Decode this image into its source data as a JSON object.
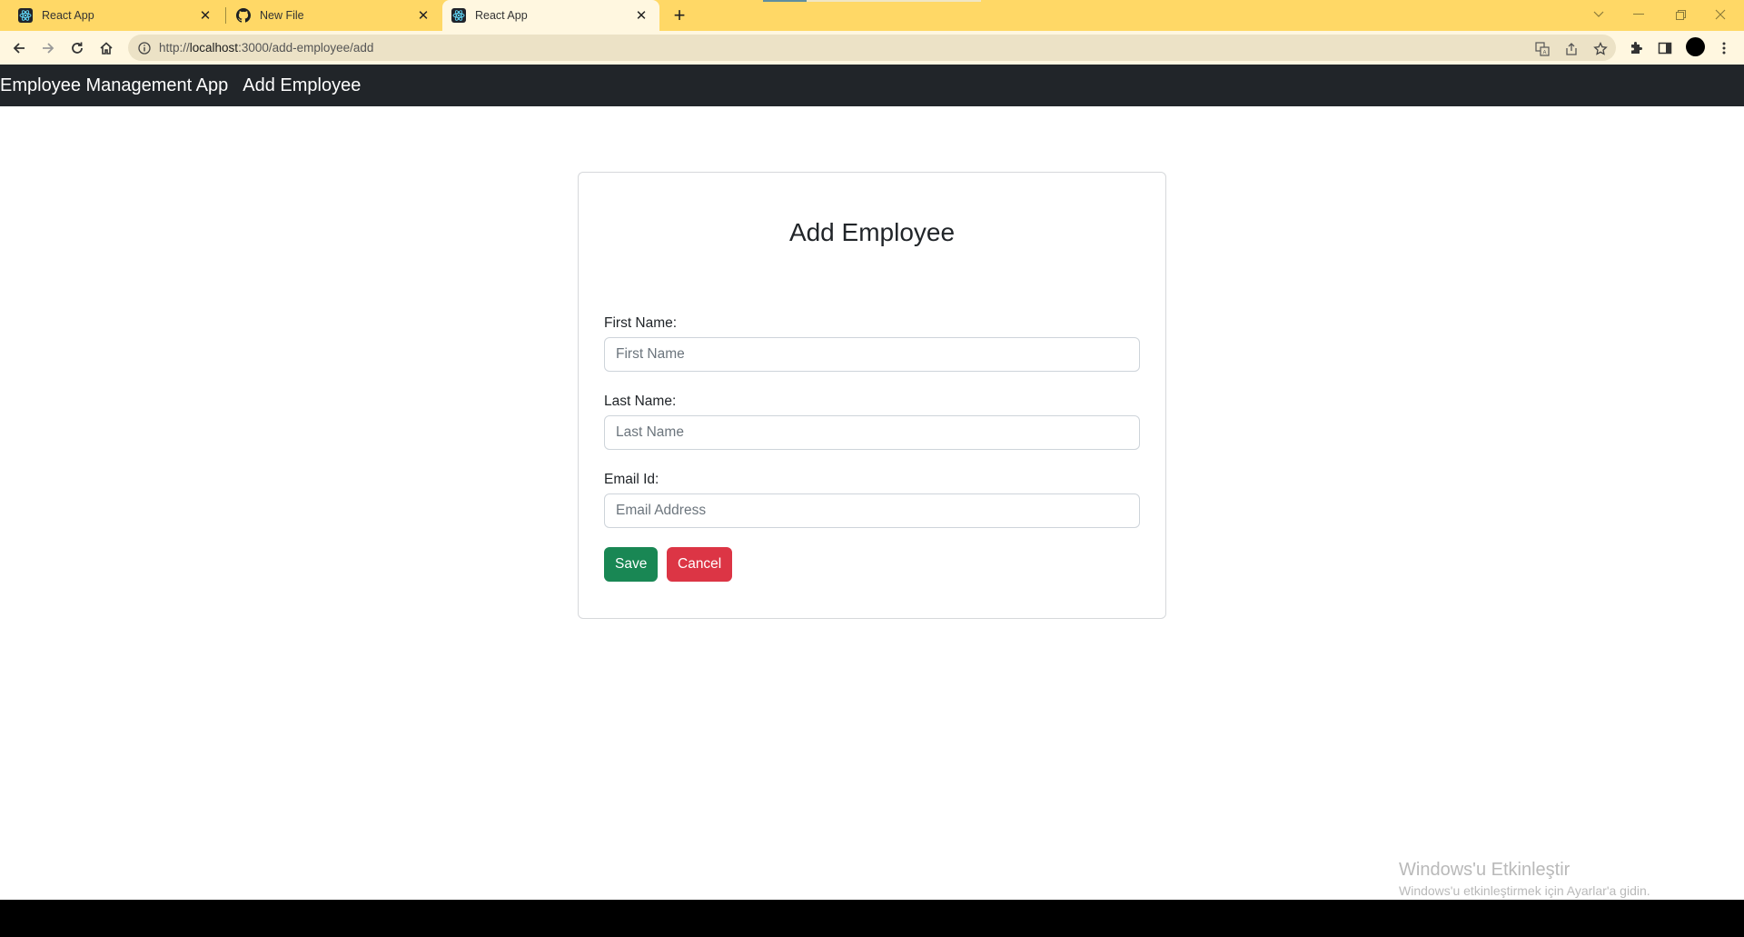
{
  "browser": {
    "tabs": [
      {
        "title": "React App",
        "favicon": "react-icon"
      },
      {
        "title": "New File",
        "favicon": "github-icon"
      },
      {
        "title": "React App",
        "favicon": "react-icon",
        "active": true
      }
    ],
    "url_prefix": "http://",
    "url_host": "localhost",
    "url_rest": ":3000/add-employee/add"
  },
  "navbar": {
    "brand": "Employee Management App",
    "link": "Add Employee",
    "background": "#212529"
  },
  "form": {
    "title": "Add Employee",
    "fields": [
      {
        "label": "First Name:",
        "placeholder": "First Name",
        "value": ""
      },
      {
        "label": "Last Name:",
        "placeholder": "Last Name",
        "value": ""
      },
      {
        "label": "Email Id:",
        "placeholder": "Email Address",
        "value": ""
      }
    ],
    "save_label": "Save",
    "cancel_label": "Cancel",
    "save_color": "#198754",
    "cancel_color": "#dc3545"
  },
  "watermark": {
    "title": "Windows'u Etkinleştir",
    "subtitle": "Windows'u etkinleştirmek için Ayarlar'a gidin."
  }
}
